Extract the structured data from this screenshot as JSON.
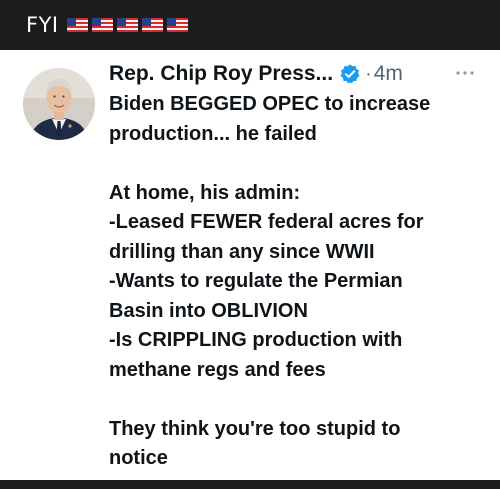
{
  "top_bar": {
    "label": "FYI",
    "flags": [
      "us-flag-icon",
      "us-flag-icon",
      "us-flag-icon",
      "us-flag-icon",
      "us-flag-icon"
    ]
  },
  "post": {
    "author": "Rep. Chip Roy Press...",
    "separator": "·",
    "time": "4m",
    "lines": [
      "Biden BEGGED OPEC to increase",
      "production... he failed",
      "",
      "At home, his admin:",
      "-Leased FEWER federal acres for",
      "drilling than any since WWII",
      "-Wants to regulate the Permian",
      "Basin into OBLIVION",
      "-Is CRIPPLING production with",
      "methane regs and fees",
      "",
      "They think you're too stupid to",
      "notice"
    ]
  },
  "colors": {
    "background": "#1c1c1e",
    "card": "#ffffff",
    "text": "#0f1419",
    "muted": "#536471",
    "verified": "#1d9bf0"
  }
}
